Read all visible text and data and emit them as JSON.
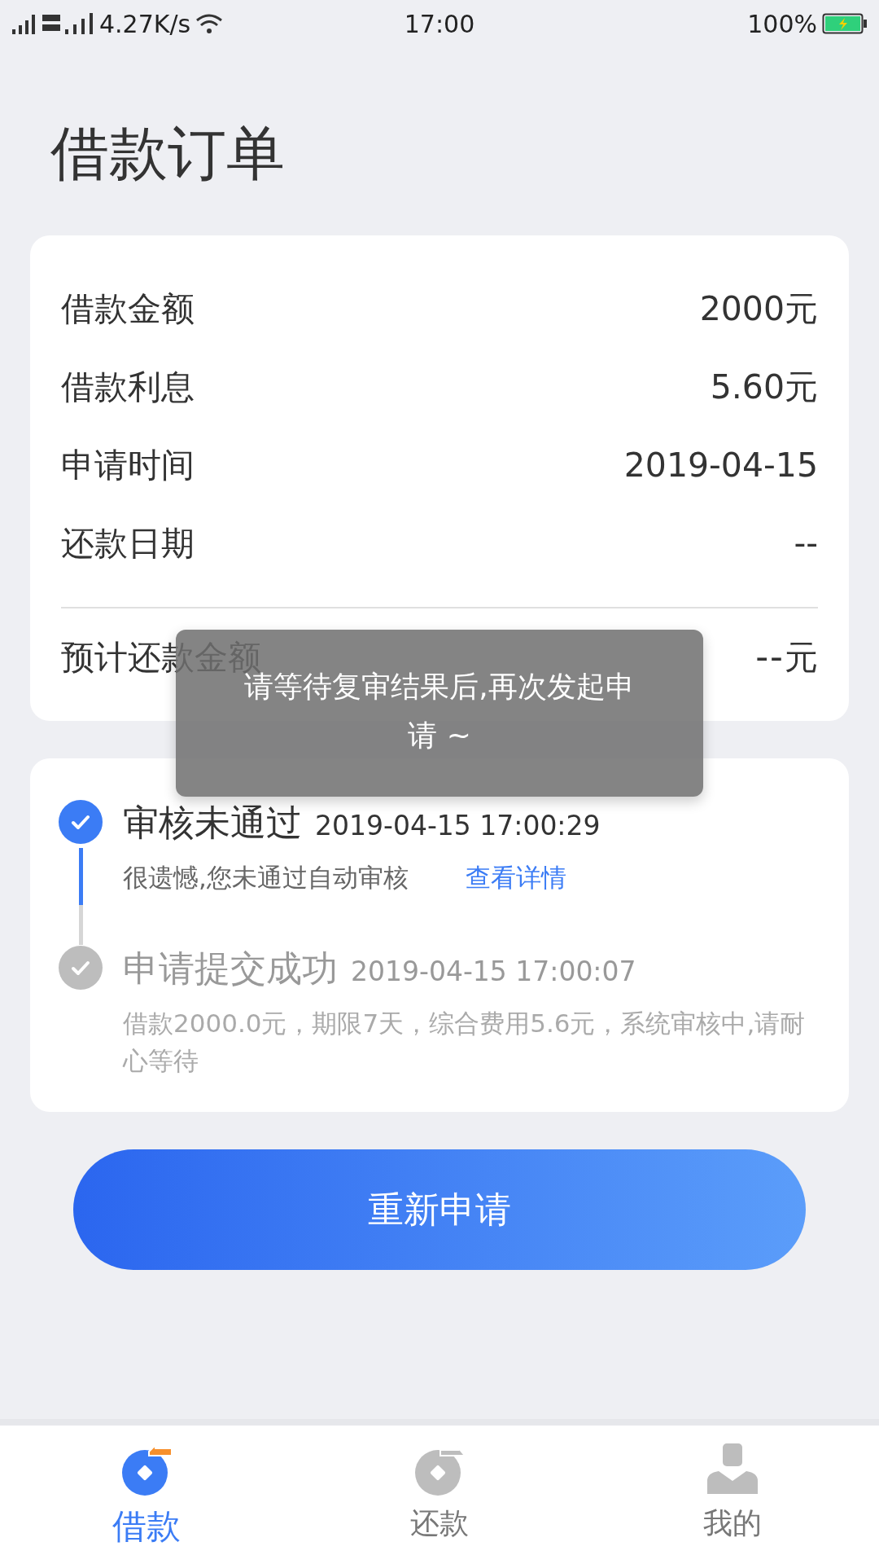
{
  "status_bar": {
    "net_speed": "4.27K/s",
    "time": "17:00",
    "battery": "100%"
  },
  "title": "借款订单",
  "summary": {
    "rows": [
      {
        "label": "借款金额",
        "value": "2000元"
      },
      {
        "label": "借款利息",
        "value": "5.60元"
      },
      {
        "label": "申请时间",
        "value": "2019-04-15"
      },
      {
        "label": "还款日期",
        "value": "--"
      }
    ],
    "total": {
      "label": "预计还款金额",
      "value": "--",
      "unit": "元"
    }
  },
  "timeline": [
    {
      "title": "审核未通过",
      "time": "2019-04-15 17:00:29",
      "detail": "很遗憾,您未通过自动审核",
      "link": "查看详情",
      "active": true
    },
    {
      "title": "申请提交成功",
      "time": "2019-04-15 17:00:07",
      "detail": "借款2000.0元，期限7天，综合费用5.6元，系统审核中,请耐心等待",
      "active": false
    }
  ],
  "reapply_button": "重新申请",
  "toast": "请等待复审结果后,再次发起申请 ~",
  "tabs": [
    {
      "label": "借款",
      "selected": true
    },
    {
      "label": "还款",
      "selected": false
    },
    {
      "label": "我的",
      "selected": false
    }
  ]
}
